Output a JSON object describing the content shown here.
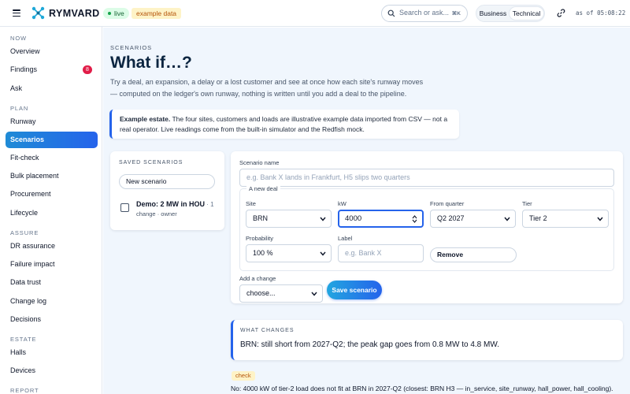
{
  "topbar": {
    "brand": "RYMVARD",
    "live_badge": "live",
    "example_badge": "example data",
    "search_placeholder": "Search or ask...",
    "search_shortcut": "⌘K",
    "mode_business": "Business",
    "mode_technical": "Technical",
    "as_of": "as of 05:08:22"
  },
  "sidebar": {
    "sections": {
      "now": "NOW",
      "plan": "PLAN",
      "assure": "ASSURE",
      "estate": "ESTATE",
      "report": "REPORT"
    },
    "items": {
      "overview": "Overview",
      "findings": "Findings",
      "findings_count": "8",
      "ask": "Ask",
      "runway": "Runway",
      "scenarios": "Scenarios",
      "fit_check": "Fit-check",
      "bulk_placement": "Bulk placement",
      "procurement": "Procurement",
      "lifecycle": "Lifecycle",
      "dr_assurance": "DR assurance",
      "failure_impact": "Failure impact",
      "data_trust": "Data trust",
      "change_log": "Change log",
      "decisions": "Decisions",
      "halls": "Halls",
      "devices": "Devices"
    }
  },
  "page": {
    "eyebrow": "SCENARIOS",
    "title": "What if…?",
    "intro_line1": "Try a deal, an expansion, a delay or a lost customer and see at once how each site's runway moves",
    "intro_line2": "— computed on the ledger's own runway, nothing is written until you add a deal to the pipeline.",
    "note_strong": "Example estate.",
    "note_line1": " The four sites, customers and loads are illustrative example data imported from CSV — not a",
    "note_line2": "real operator. Live readings come from the built-in simulator and the Redfish mock."
  },
  "saved": {
    "label": "SAVED SCENARIOS",
    "new_button": "New scenario",
    "item_title": "Demo: 2 MW in HOU",
    "item_count": " · 1",
    "item_sub": "change · owner"
  },
  "form": {
    "name_label": "Scenario name",
    "name_placeholder": "e.g. Bank X lands in Frankfurt, H5 slips two quarters",
    "new_deal_legend": "A new deal",
    "site_label": "Site",
    "site_value": "BRN",
    "kw_label": "kW",
    "kw_value": "4000",
    "quarter_label": "From quarter",
    "quarter_value": "Q2 2027",
    "tier_label": "Tier",
    "tier_value": "Tier 2",
    "probability_label": "Probability",
    "probability_value": "100 %",
    "deal_label": "Label",
    "deal_placeholder": "e.g. Bank X",
    "remove_button": "Remove",
    "add_change_label": "Add a change",
    "add_change_value": "choose...",
    "save_button": "Save scenario"
  },
  "changes": {
    "label": "WHAT CHANGES",
    "text": "BRN: still short from 2027-Q2; the peak gap goes from 0.8 MW to 4.8 MW."
  },
  "check": {
    "tag": "check",
    "text": "No: 4000 kW of tier-2 load does not fit at BRN in 2027-Q2 (closest: BRN H3 — in_service, site_runway, hall_power, hall_cooling)."
  },
  "colors": {
    "accent": "#2563eb",
    "accent_light": "#22a6e0",
    "brand": "#0f172a",
    "live": "#16a34a",
    "alert": "#e11d48",
    "warning_bg": "#fef3c7"
  },
  "icons": [
    "menu-icon",
    "logo-icon",
    "search-icon",
    "link-icon",
    "chevron-down-icon",
    "spinner-icon"
  ]
}
